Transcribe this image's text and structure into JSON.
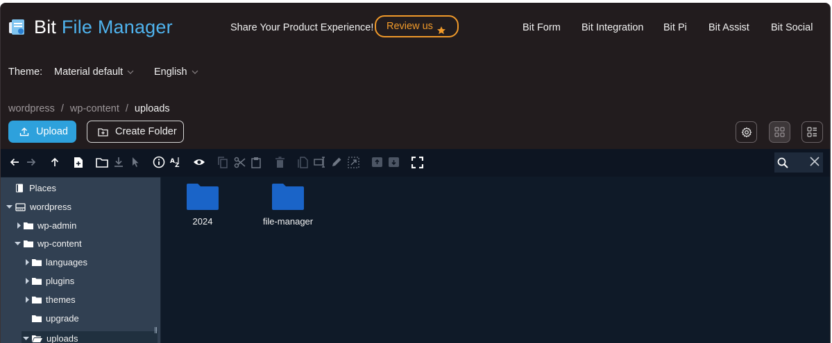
{
  "header": {
    "logo_part1": "Bit",
    "logo_part2": "File Manager",
    "promo_text": "Share Your Product Experience!",
    "review_label": "Review us",
    "nav": [
      "Bit Form",
      "Bit Integration",
      "Bit Pi",
      "Bit Assist",
      "Bit Social"
    ]
  },
  "settings": {
    "theme_label": "Theme:",
    "theme_value": "Material default",
    "language_value": "English"
  },
  "breadcrumb": [
    "wordpress",
    "wp-content",
    "uploads"
  ],
  "actions": {
    "upload_label": "Upload",
    "create_folder_label": "Create Folder"
  },
  "tree": {
    "places": "Places",
    "root": "wordpress",
    "items": [
      {
        "label": "wp-admin"
      },
      {
        "label": "wp-content"
      },
      {
        "label": "languages"
      },
      {
        "label": "plugins"
      },
      {
        "label": "themes"
      },
      {
        "label": "upgrade"
      },
      {
        "label": "uploads"
      }
    ]
  },
  "files": [
    {
      "name": "2024",
      "type": "folder"
    },
    {
      "name": "file-manager",
      "type": "folder"
    }
  ],
  "colors": {
    "accent": "#2ea1dc",
    "review": "#f19a2a",
    "folder": "#1a64c8",
    "background": "#221c1e"
  }
}
